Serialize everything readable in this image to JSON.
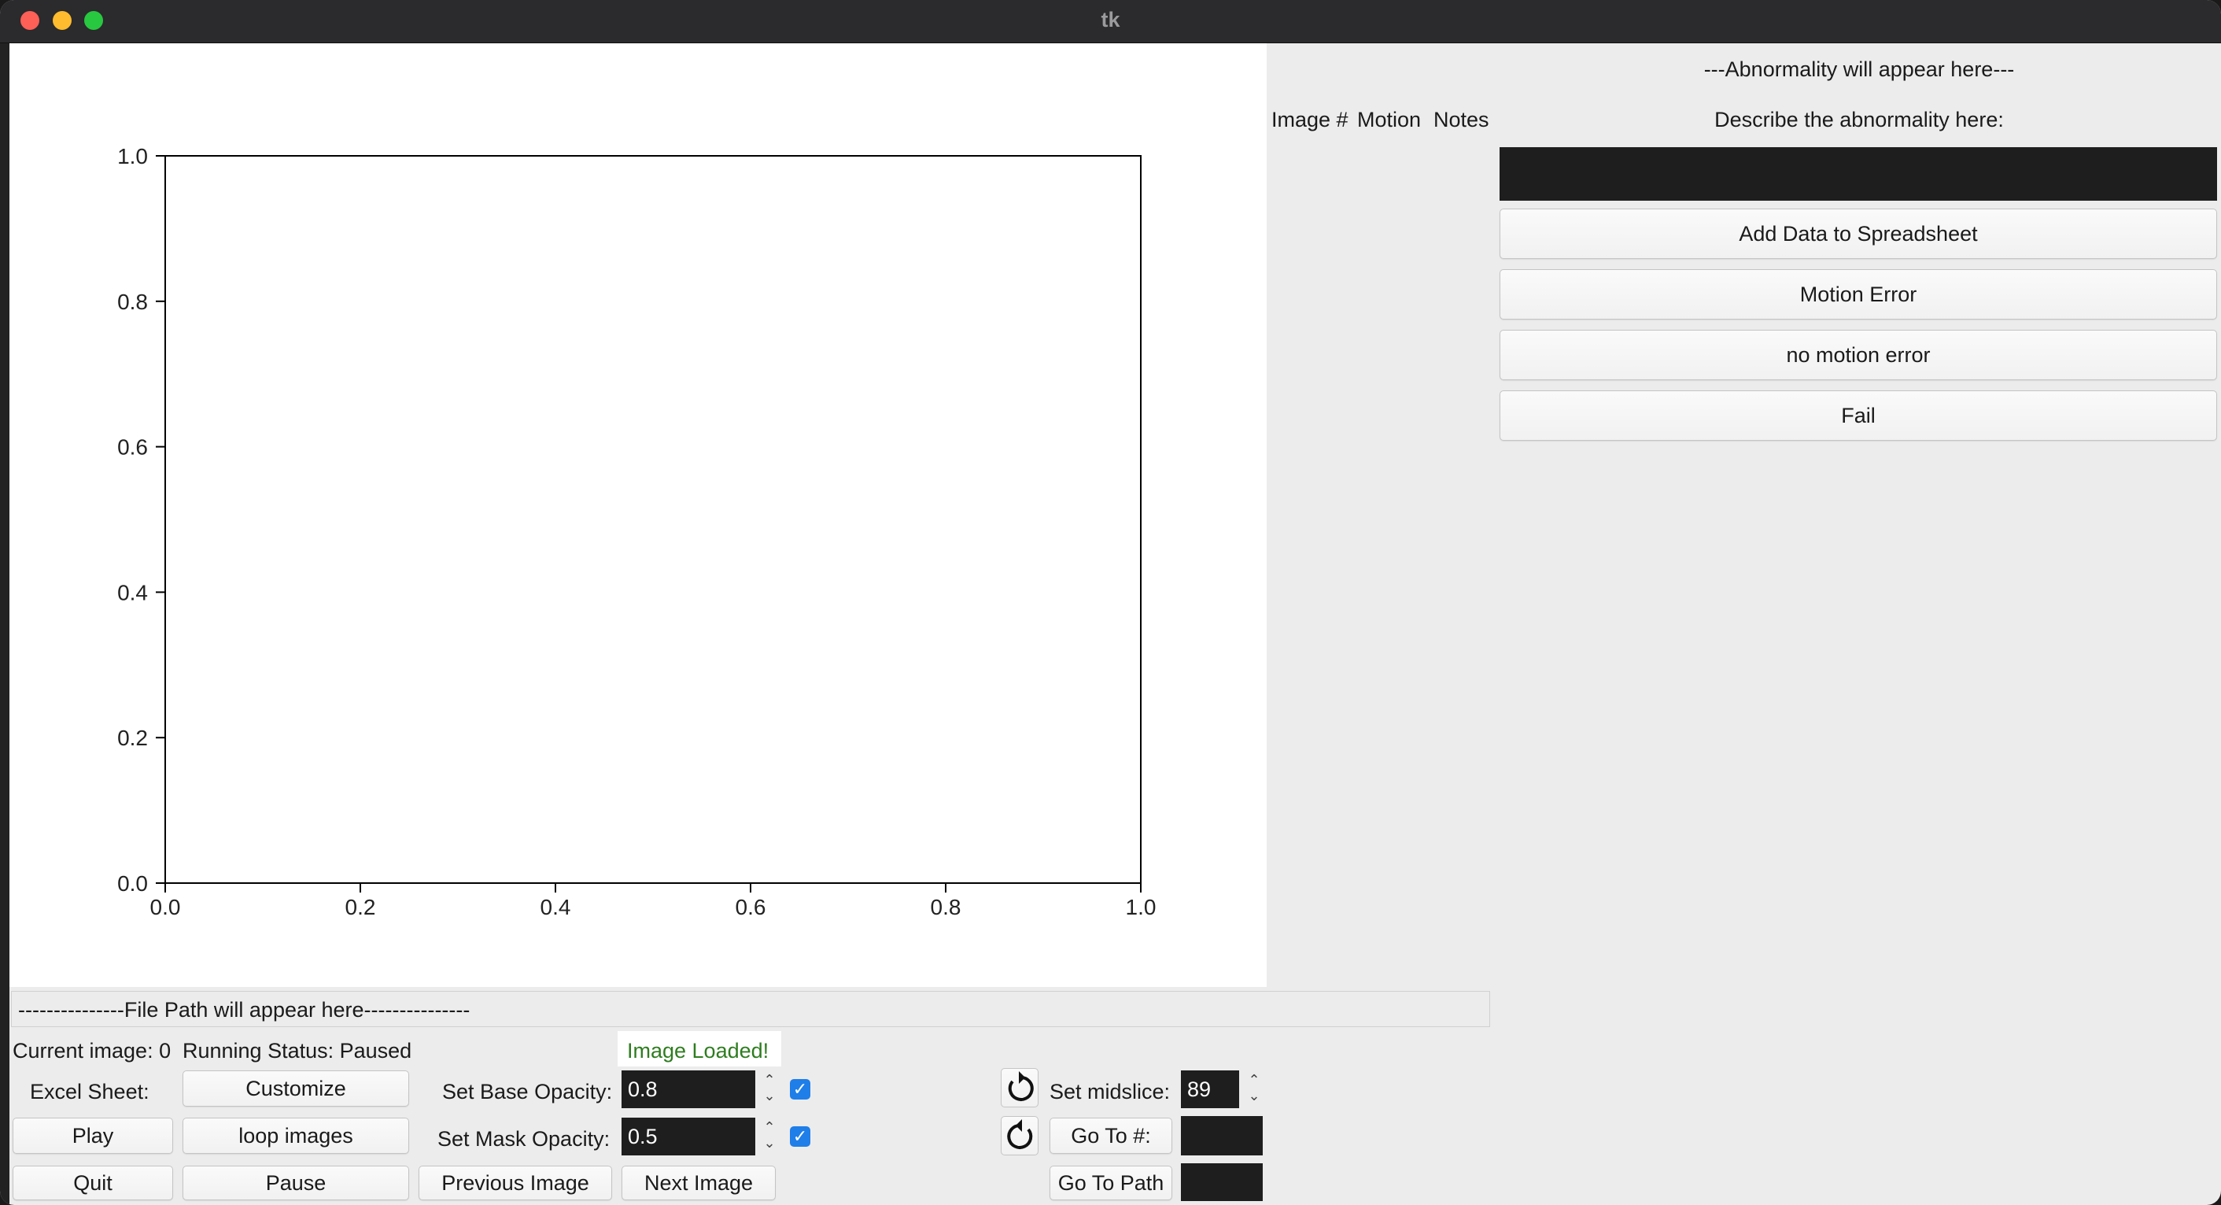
{
  "window": {
    "title": "tk"
  },
  "chart_data": {
    "type": "scatter",
    "x": [],
    "y": [],
    "xlim": [
      0.0,
      1.0
    ],
    "ylim": [
      0.0,
      1.0
    ],
    "xticks": [
      "0.0",
      "0.2",
      "0.4",
      "0.6",
      "0.8",
      "1.0"
    ],
    "yticks": [
      "0.0",
      "0.2",
      "0.4",
      "0.6",
      "0.8",
      "1.0"
    ],
    "grid": false
  },
  "table_header": {
    "image_num": "Image #",
    "motion": "Motion",
    "notes": "Notes"
  },
  "abnormality": {
    "title": "---Abnormality will appear here---",
    "describe_label": "Describe the abnormality here:",
    "input_value": ""
  },
  "right_buttons": {
    "add_data": "Add Data to Spreadsheet",
    "motion_error": "Motion Error",
    "no_motion_error": "no motion error",
    "fail": "Fail"
  },
  "file_path": "---------------File Path will appear here---------------",
  "status": {
    "current_image": "Current image: 0",
    "running_status": "Running Status: Paused",
    "image_loaded": "Image Loaded!",
    "image_loaded_color": "#2e7d1f"
  },
  "controls": {
    "excel_label": "Excel Sheet:",
    "customize": "Customize",
    "play": "Play",
    "loop_images": "loop images",
    "quit": "Quit",
    "pause": "Pause",
    "previous_image": "Previous Image",
    "next_image": "Next Image",
    "base_opacity_label": "Set Base Opacity:",
    "base_opacity_value": "0.8",
    "mask_opacity_label": "Set Mask Opacity:",
    "mask_opacity_value": "0.5",
    "midslice_label": "Set midslice:",
    "midslice_value": "89",
    "goto_num": "Go To #:",
    "goto_num_value": "",
    "goto_path": "Go To Path",
    "goto_path_value": ""
  },
  "colors": {
    "accent": "#1f7ee8",
    "entry_bg": "#1e1e1e",
    "panel_bg": "#ececec"
  }
}
